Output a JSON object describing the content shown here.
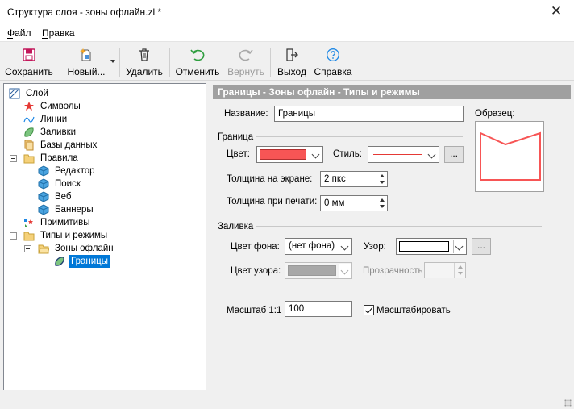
{
  "window": {
    "title": "Структура слоя - зоны офлайн.zl *"
  },
  "menu": {
    "file": "Файл",
    "help": "Правка"
  },
  "toolbar": {
    "save": "Сохранить",
    "new": "Новый...",
    "delete": "Удалить",
    "undo": "Отменить",
    "redo": "Вернуть",
    "exit": "Выход",
    "help": "Справка"
  },
  "tree": {
    "root": "Слой",
    "symbols": "Символы",
    "lines": "Линии",
    "fills": "Заливки",
    "databases": "Базы данных",
    "rules": "Правила",
    "editor": "Редактор",
    "search": "Поиск",
    "web": "Веб",
    "banners": "Баннеры",
    "primitives": "Примитивы",
    "types_modes": "Типы и режимы",
    "offline_zones": "Зоны офлайн",
    "borders": "Границы"
  },
  "panel": {
    "header": "Границы - Зоны офлайн - Типы и режимы",
    "name_label": "Название:",
    "name_value": "Границы",
    "sample_label": "Образец:",
    "border_group": "Граница",
    "color_label": "Цвет:",
    "style_label": "Стиль:",
    "screen_width_label": "Толщина на экране:",
    "screen_width_value": "2 пкс",
    "print_width_label": "Толщина при печати:",
    "print_width_value": "0 мм",
    "fill_group": "Заливка",
    "bg_color_label": "Цвет фона:",
    "bg_color_value": "(нет фона)",
    "pattern_label": "Узор:",
    "pattern_color_label": "Цвет узора:",
    "transparency_label": "Прозрачность",
    "scale_label": "Масштаб 1:1",
    "scale_value": "100",
    "scale_checkbox_label": "Масштабировать",
    "more_button": "..."
  },
  "colors": {
    "border_color": "#f75555",
    "pattern_color": "#a8a8a8",
    "selection": "#0078d7",
    "header_bg": "#a0a0a0"
  }
}
